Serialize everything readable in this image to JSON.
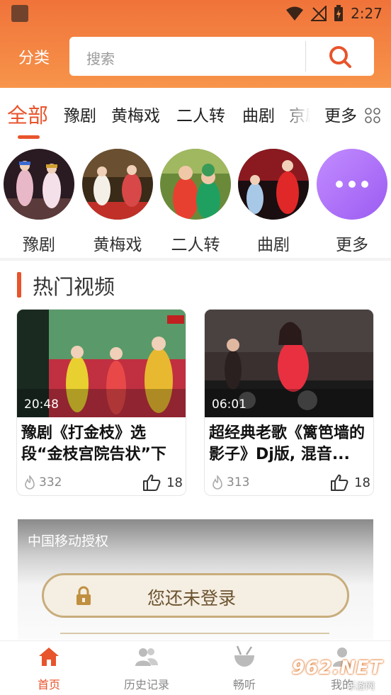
{
  "status_bar": {
    "time": "2:27"
  },
  "header": {
    "category_label": "分类",
    "search_placeholder": "搜索"
  },
  "tabs": [
    {
      "label": "全部",
      "active": true
    },
    {
      "label": "豫剧"
    },
    {
      "label": "黄梅戏"
    },
    {
      "label": "二人转"
    },
    {
      "label": "曲剧"
    },
    {
      "label": "京剧"
    },
    {
      "label": "更多"
    }
  ],
  "circles": [
    {
      "label": "豫剧"
    },
    {
      "label": "黄梅戏"
    },
    {
      "label": "二人转"
    },
    {
      "label": "曲剧"
    },
    {
      "label": "更多"
    }
  ],
  "hot_section": {
    "title": "热门视频",
    "videos": [
      {
        "duration": "20:48",
        "title": "豫剧《打金枝》选段“金枝宫院告状”下",
        "views": "332",
        "likes": "18"
      },
      {
        "duration": "06:01",
        "title": "超经典老歌《篱笆墙的影子》Dj版, 混音...",
        "views": "313",
        "likes": "18"
      }
    ]
  },
  "banner": {
    "provider_text": "中国移动授权",
    "login_label": "您还未登录"
  },
  "bottom_nav": [
    {
      "label": "首页",
      "active": true
    },
    {
      "label": "历史记录"
    },
    {
      "label": "畅听"
    },
    {
      "label": "我的"
    }
  ],
  "watermark": {
    "text": "962.NET",
    "sub": "乐游网"
  },
  "colors": {
    "accent": "#e8542c",
    "header": "#f37e3e",
    "more_circle": "#a86af5",
    "login_border": "#c8ad7c"
  }
}
